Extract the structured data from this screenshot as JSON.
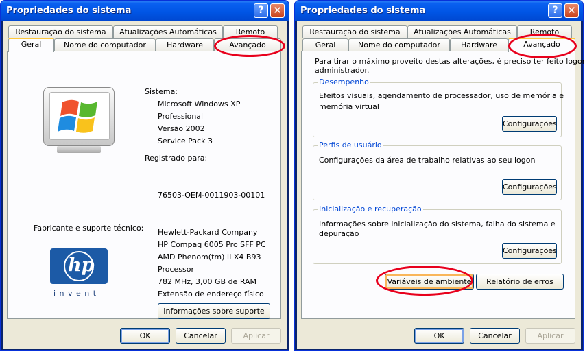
{
  "left_window": {
    "title": "Propriedades do sistema",
    "help_glyph": "?",
    "close_glyph": "✕",
    "tabs_row1": [
      "Restauração do sistema",
      "Atualizações Automáticas",
      "Remoto"
    ],
    "tabs_row2": [
      "Geral",
      "Nome do computador",
      "Hardware",
      "Avançado"
    ],
    "active_tab": "Geral",
    "system_label": "Sistema:",
    "system_lines": [
      "Microsoft Windows XP",
      "Professional",
      "Versão 2002",
      "Service Pack 3"
    ],
    "registered_label": "Registrado para:",
    "serial": "76503-OEM-0011903-00101",
    "manufacturer_label": "Fabricante e suporte técnico:",
    "manufacturer_lines": [
      "Hewlett-Packard Company",
      "HP Compaq 6005 Pro SFF PC",
      "AMD Phenom(tm) II X4 B93",
      "Processor",
      "782 MHz, 3,00 GB de RAM",
      "Extensão de endereço físico"
    ],
    "hp_logo_text": "hp",
    "hp_invent": "i n v e n t",
    "support_button": "Informações sobre suporte",
    "ok": "OK",
    "cancel": "Cancelar",
    "apply": "Aplicar"
  },
  "right_window": {
    "title": "Propriedades do sistema",
    "help_glyph": "?",
    "close_glyph": "✕",
    "tabs_row1": [
      "Restauração do sistema",
      "Atualizações Automáticas",
      "Remoto"
    ],
    "tabs_row2": [
      "Geral",
      "Nome do computador",
      "Hardware",
      "Avançado"
    ],
    "active_tab": "Avançado",
    "intro_line1": "Para tirar o máximo proveito destas alterações, é preciso ter feito logon como",
    "intro_line2": "administrador.",
    "perf_label": "Desempenho",
    "perf_line1": "Efeitos visuais, agendamento de processador, uso de memória e",
    "perf_line2": "memória virtual",
    "profiles_label": "Perfis de usuário",
    "profiles_line1": "Configurações da área de trabalho relativas ao seu logon",
    "startup_label": "Inicialização e recuperação",
    "startup_line1": "Informações sobre inicialização do sistema, falha do sistema e",
    "startup_line2": "depuração",
    "settings_button": "Configurações",
    "env_button": "Variáveis de ambiente",
    "error_button": "Relatório de erros",
    "ok": "OK",
    "cancel": "Cancelar",
    "apply": "Aplicar"
  },
  "colors": {
    "title_bar": "#0055e5",
    "dialog_bg": "#ece9d8",
    "group_label": "#0046d5",
    "highlight_ring": "#e8001c",
    "active_tab_accent": "#ffc83c"
  }
}
